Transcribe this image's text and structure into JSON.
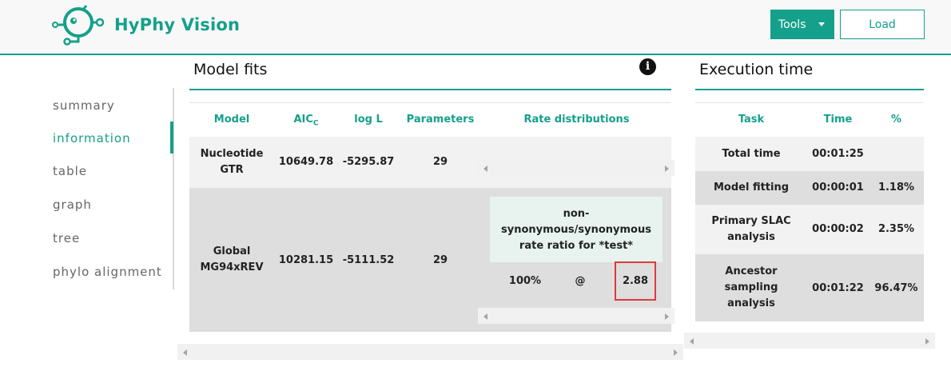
{
  "header": {
    "brand": "HyPhy Vision",
    "tools_label": "Tools",
    "load_label": "Load",
    "accent_color": "#14a08a"
  },
  "sidebar": {
    "items": [
      {
        "label": "summary"
      },
      {
        "label": "information",
        "active": true
      },
      {
        "label": "table"
      },
      {
        "label": "graph"
      },
      {
        "label": "tree"
      },
      {
        "label": "phylo alignment"
      }
    ]
  },
  "model_fits": {
    "title": "Model fits",
    "columns": {
      "model": "Model",
      "aic": "AIC",
      "aic_sub": "C",
      "logl": "log L",
      "params": "Parameters",
      "rates": "Rate distributions"
    },
    "rows": [
      {
        "model_line1": "Nucleotide",
        "model_line2": "GTR",
        "aic": "10649.78",
        "logl": "-5295.87",
        "params": "29"
      },
      {
        "model_line1": "Global",
        "model_line2": "MG94xREV",
        "aic": "10281.15",
        "logl": "-5111.52",
        "params": "29",
        "rate": {
          "line1": "non-",
          "line2": "synonymous/synonymous",
          "line3": "rate ratio for *test*",
          "weight": "100%",
          "at": "@",
          "value": "2.88"
        }
      }
    ]
  },
  "execution_time": {
    "title": "Execution time",
    "columns": {
      "task": "Task",
      "time": "Time",
      "pct": "%"
    },
    "rows": [
      {
        "task_line1": "Total time",
        "time": "00:01:25",
        "pct": ""
      },
      {
        "task_line1": "Model fitting",
        "time": "00:00:01",
        "pct": "1.18%"
      },
      {
        "task_line1": "Primary SLAC",
        "task_line2": "analysis",
        "time": "00:00:02",
        "pct": "2.35%"
      },
      {
        "task_line1": "Ancestor",
        "task_line2": "sampling",
        "task_line3": "analysis",
        "time": "00:01:22",
        "pct": "96.47%"
      }
    ]
  }
}
